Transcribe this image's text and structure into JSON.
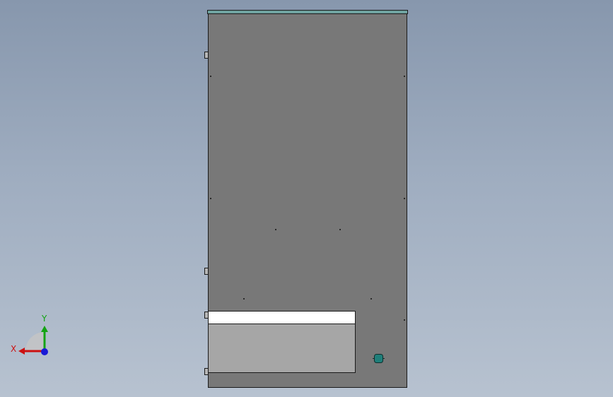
{
  "viewport": {
    "background_top": "#8797ad",
    "background_bottom": "#b7c2d0"
  },
  "model": {
    "body_color": "#787878",
    "top_cap_color": "#6fa3a0",
    "panel_color": "#a6a6a6",
    "panel_header_color": "#ffffff",
    "handle_color": "#1f7f7a"
  },
  "triad": {
    "x_label": "X",
    "y_label": "Y",
    "x_color": "#cc1111",
    "y_color": "#13a313",
    "z_color": "#1a1ad6"
  }
}
